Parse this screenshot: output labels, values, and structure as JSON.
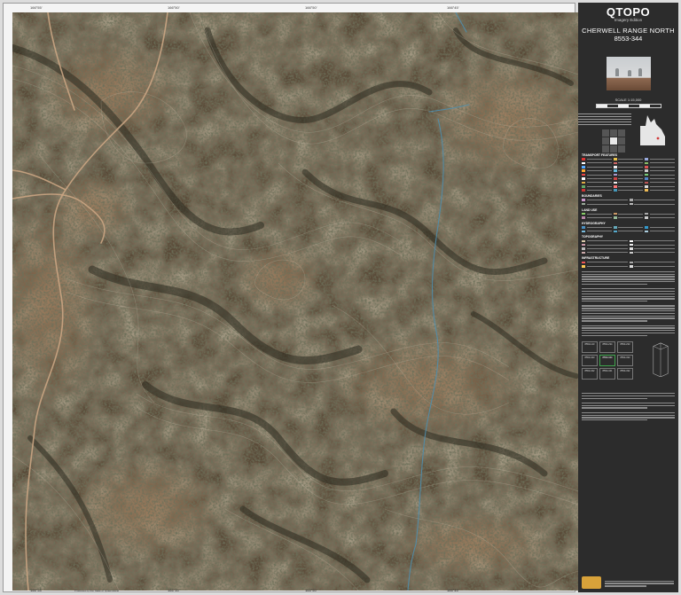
{
  "map": {
    "grid_top": [
      "166°55'",
      "166°50'",
      "166°50'",
      "166°45'"
    ],
    "grid_bottom": [
      "166°55'",
      "166°50'",
      "166°50'",
      "166°45'"
    ],
    "footer": "Produced by the State of Queensland"
  },
  "panel": {
    "brand": "QTOPO",
    "brand_sub": "Imagery Edition",
    "map_name": "CHERWELL RANGE NORTH",
    "map_number": "8553-344",
    "scale": "SCALE 1:15,000",
    "legend_heads": [
      "TRANSPORT FEATURES",
      "BOUNDARIES",
      "LAND USE",
      "HYDROGRAPHY",
      "TOPOGRAPHY",
      "INFRASTRUCTURE"
    ],
    "index": {
      "cells": [
        "8553-143",
        "8553-234",
        "8553-233",
        "8553-343",
        "8553-344",
        "8553-333",
        "8553-342",
        "8553-341",
        "8553-332"
      ]
    }
  },
  "colors": {
    "terrain_dark": "#3f3b2c",
    "terrain_light": "#8a6d52",
    "track": "#c9a27f",
    "panel_bg": "#2c2c2c",
    "index_highlight": "#3fa34d"
  }
}
